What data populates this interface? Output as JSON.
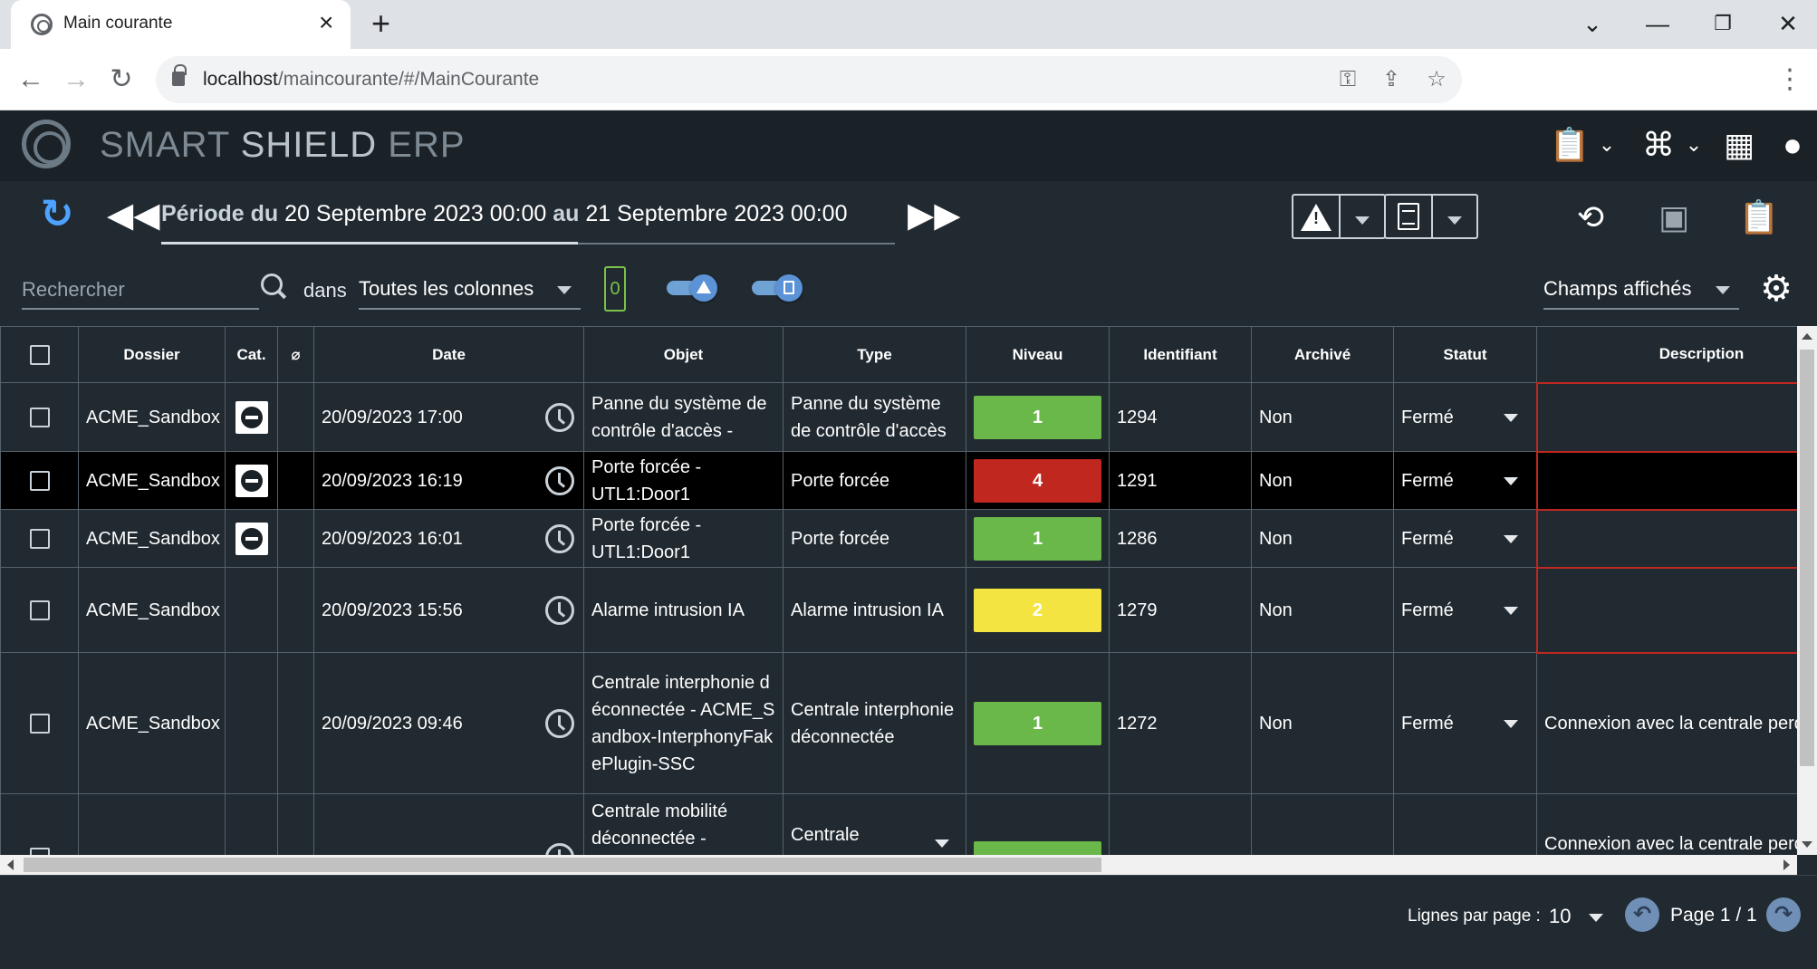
{
  "browser": {
    "tab_title": "Main courante",
    "url_host": "localhost",
    "url_path": "/maincourante/#/MainCourante"
  },
  "app": {
    "logo_light": "SMART ",
    "logo_bold": "SHIELD",
    "logo_suffix": " ERP"
  },
  "period": {
    "label_from": "Période du",
    "from": "20 Septembre 2023 00:00",
    "label_to": "au",
    "to": "21 Septembre 2023 00:00"
  },
  "search": {
    "placeholder": "Rechercher",
    "in_label": "dans",
    "column_select": "Toutes les colonnes",
    "counter": "0",
    "fields_select": "Champs affichés"
  },
  "table": {
    "headers": {
      "dossier": "Dossier",
      "cat": "Cat.",
      "date": "Date",
      "objet": "Objet",
      "type": "Type",
      "niveau": "Niveau",
      "identifiant": "Identifiant",
      "archive": "Archivé",
      "statut": "Statut",
      "description": "Description"
    },
    "rows": [
      {
        "dossier": "ACME_Sandbox",
        "date": "20/09/2023 17:00",
        "objet": "Panne du système de contrôle d'accès -",
        "type": "Panne du système de contrôle d'accès",
        "niveau": "1",
        "identifiant": "1294",
        "archive": "Non",
        "statut": "Fermé",
        "description": ""
      },
      {
        "dossier": "ACME_Sandbox",
        "date": "20/09/2023 16:19",
        "objet": "Porte forcée - UTL1:Door1",
        "type": "Porte forcée",
        "niveau": "4",
        "identifiant": "1291",
        "archive": "Non",
        "statut": "Fermé",
        "description": ""
      },
      {
        "dossier": "ACME_Sandbox",
        "date": "20/09/2023 16:01",
        "objet": "Porte forcée - UTL1:Door1",
        "type": "Porte forcée",
        "niveau": "1",
        "identifiant": "1286",
        "archive": "Non",
        "statut": "Fermé",
        "description": ""
      },
      {
        "dossier": "ACME_Sandbox",
        "date": "20/09/2023 15:56",
        "objet": "Alarme intrusion IA",
        "type": "Alarme intrusion IA",
        "niveau": "2",
        "identifiant": "1279",
        "archive": "Non",
        "statut": "Fermé",
        "description": ""
      },
      {
        "dossier": "ACME_Sandbox",
        "date": "20/09/2023 09:46",
        "objet": "Centrale interphonie déconnectée - ACME_Sandbox-InterphonyFakePlugin-SSC",
        "type": "Centrale interphonie déconnectée",
        "niveau": "1",
        "identifiant": "1272",
        "archive": "Non",
        "statut": "Fermé",
        "description": "Connexion avec la centrale perdue ACME_Sandbox-InterphonyFake"
      },
      {
        "dossier": "",
        "date": "",
        "objet": "Centrale mobilité déconnectée -",
        "type": "Centrale",
        "niveau": "",
        "identifiant": "",
        "archive": "",
        "statut": "",
        "description": "Connexion avec la centrale perdue"
      }
    ]
  },
  "colors": {
    "level_1": "#6ab74a",
    "level_2": "#f4e442",
    "level_4": "#c0281f"
  },
  "footer": {
    "rows_label": "Lignes par page :",
    "rows_value": "10",
    "page_label": "Page 1 / 1"
  }
}
